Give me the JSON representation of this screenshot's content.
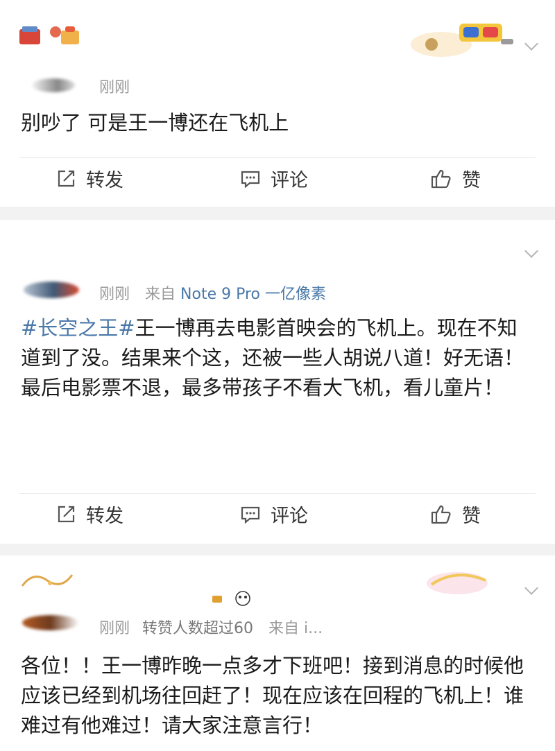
{
  "posts": [
    {
      "time": "刚刚",
      "text": "别吵了 可是王一博还在飞机上",
      "actions": {
        "repost": "转发",
        "comment": "评论",
        "like": "赞"
      }
    },
    {
      "time": "刚刚",
      "source_prefix": "来自",
      "source": "Note 9 Pro 一亿像素",
      "topic": "#长空之王#",
      "text_line1": "王一博再去电影首映会的飞机上。现在不知道到了没。结果来个这，还被一些人胡说八道！好无语！",
      "text_line2": "最后电影票不退，最多带孩子不看大飞机，看儿童片！",
      "actions": {
        "repost": "转发",
        "comment": "评论",
        "like": "赞"
      }
    },
    {
      "time": "刚刚",
      "meta": "转赞人数超过60",
      "source_prefix": "来自",
      "source": "i...",
      "text": "各位！！王一博昨晚一点多才下班吧！接到消息的时候他应该已经到机场往回赶了！现在应该在回程的飞机上！谁难过有他难过！请大家注意言行！"
    }
  ],
  "colors": {
    "topic": "#4a78a8",
    "background": "#f2f2f2"
  },
  "icons": [
    "repost-icon",
    "comment-icon",
    "like-icon",
    "chevron-down-icon"
  ]
}
